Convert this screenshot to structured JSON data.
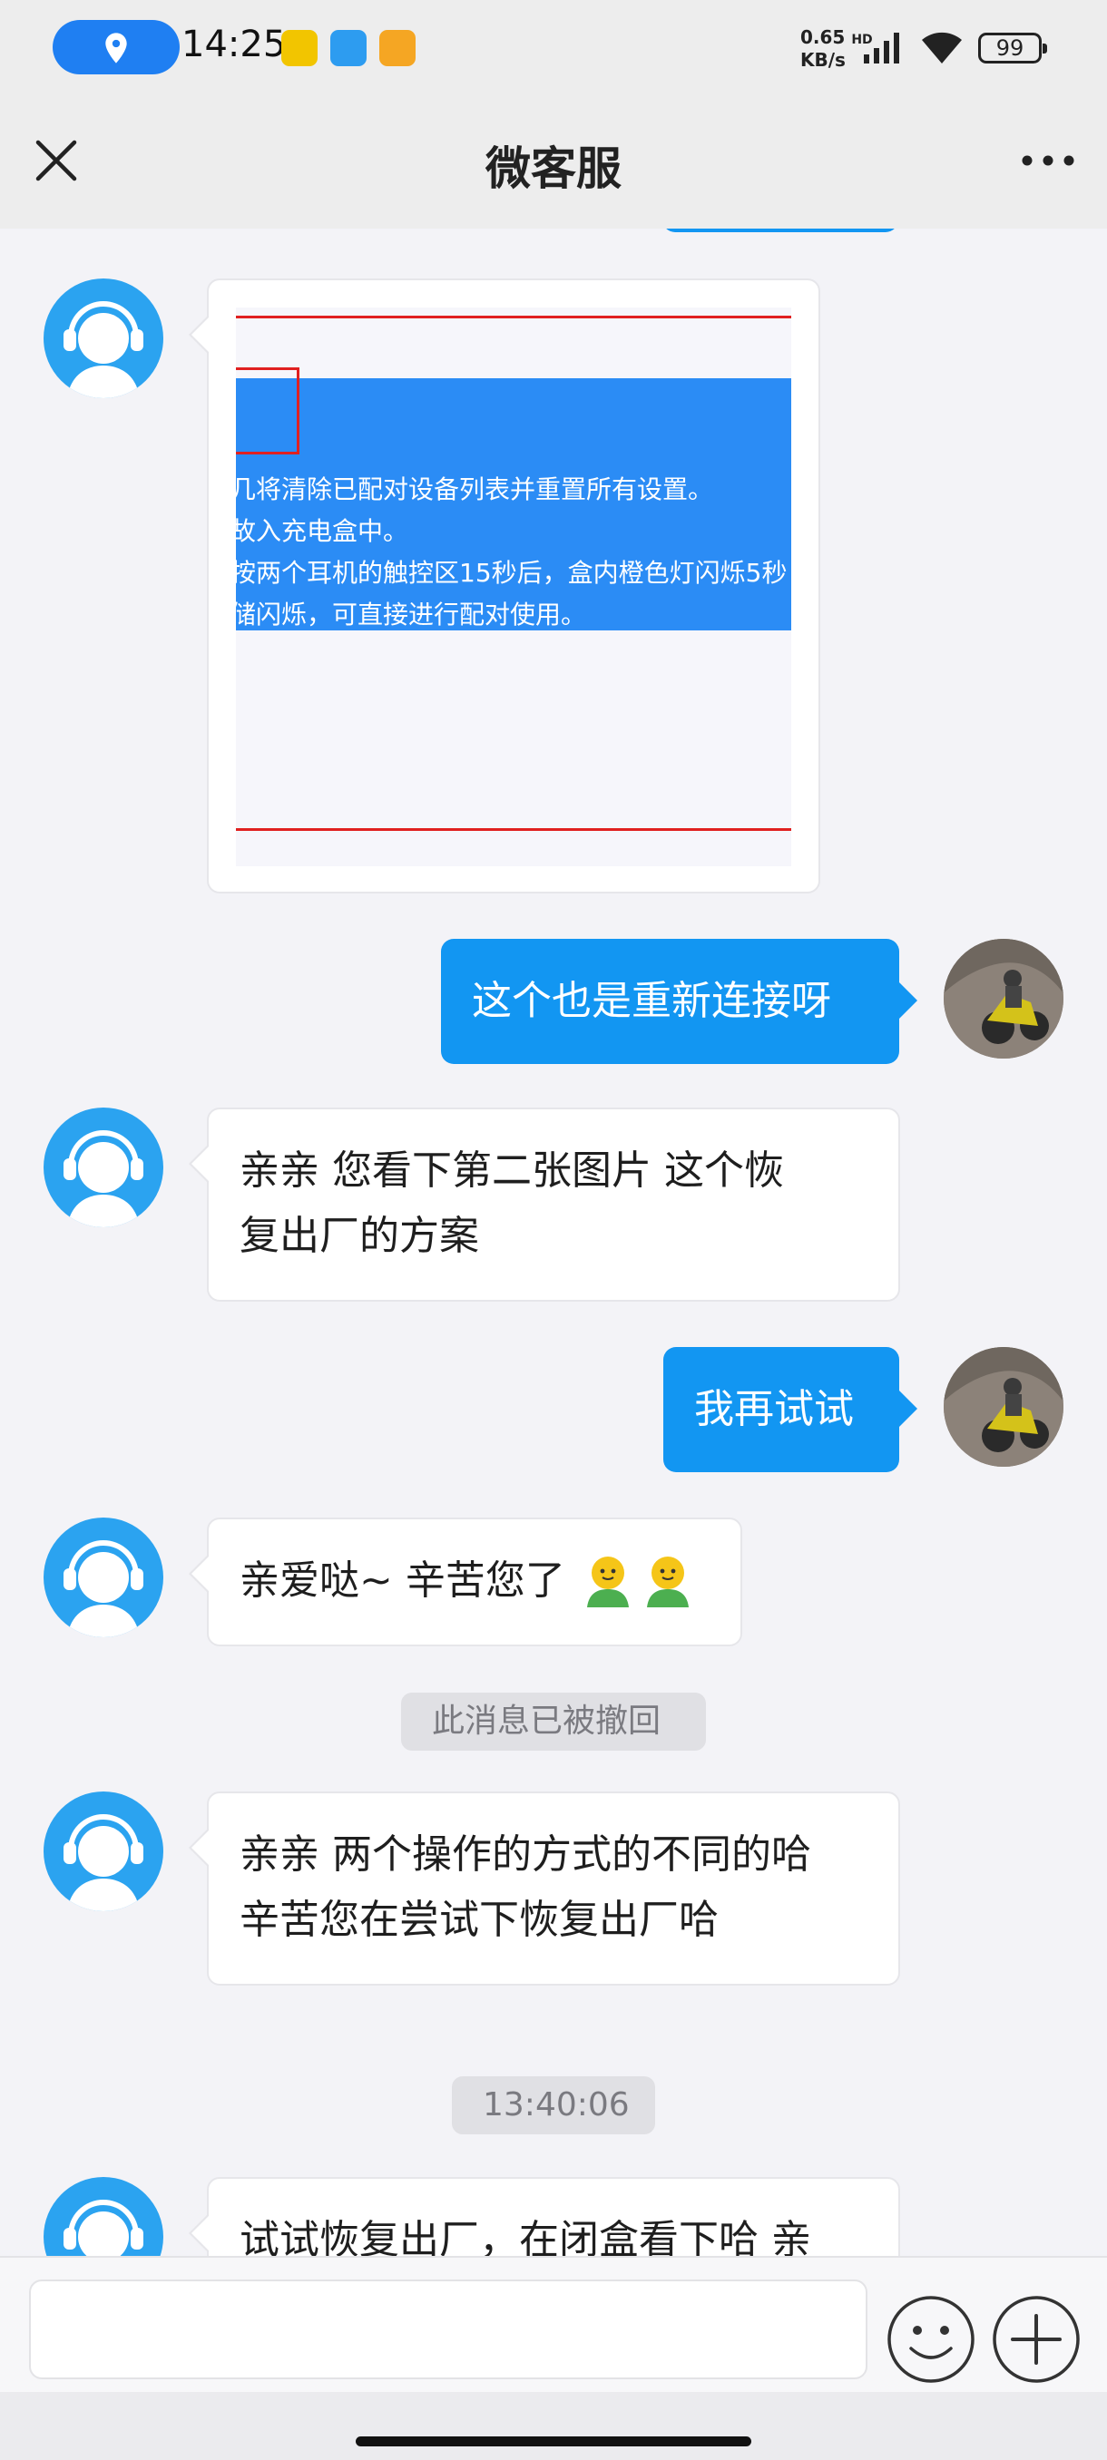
{
  "status_bar": {
    "time": "14:25",
    "net_speed_value": "0.65",
    "net_speed_unit": "KB/s",
    "net_type": "HD",
    "battery": "99"
  },
  "header": {
    "title": "微客服"
  },
  "messages": [
    {
      "from": "agent",
      "type": "image",
      "image_text": [
        "几将清除已配对设备列表并重置所有设置。",
        "故入充电盒中。",
        "按两个耳机的触控区15秒后，盒内橙色灯闪烁5秒",
        "储闪烁，可直接进行配对使用。"
      ]
    },
    {
      "from": "user",
      "type": "text",
      "text": "这个也是重新连接呀"
    },
    {
      "from": "agent",
      "type": "text",
      "lines": [
        "亲亲 您看下第二张图片 这个恢",
        "复出厂的方案"
      ]
    },
    {
      "from": "user",
      "type": "text",
      "text": "我再试试"
    },
    {
      "from": "agent",
      "type": "text",
      "text": "亲爱哒~ 辛苦您了",
      "emojis": [
        "smiling-face-emoji",
        "smiling-face-emoji"
      ]
    },
    {
      "type": "system",
      "text": "此消息已被撤回"
    },
    {
      "from": "agent",
      "type": "text",
      "lines": [
        "亲亲 两个操作的方式的不同的哈",
        "辛苦您在尝试下恢复出厂哈"
      ]
    },
    {
      "type": "timestamp",
      "text": "13:40:06"
    },
    {
      "from": "agent",
      "type": "text",
      "text": "试试恢复出厂，在闭盒看下哈 亲"
    }
  ],
  "input": {
    "value": "",
    "placeholder": ""
  },
  "icons": {
    "close": "close-icon",
    "more": "more-icon",
    "emoji": "emoji-icon",
    "plus": "plus-icon",
    "location": "location-icon"
  },
  "colors": {
    "accent": "#1296f2",
    "agent_avatar": "#2ba3f0",
    "page_bg": "#f3f3f7",
    "header_bg": "#ededed"
  }
}
